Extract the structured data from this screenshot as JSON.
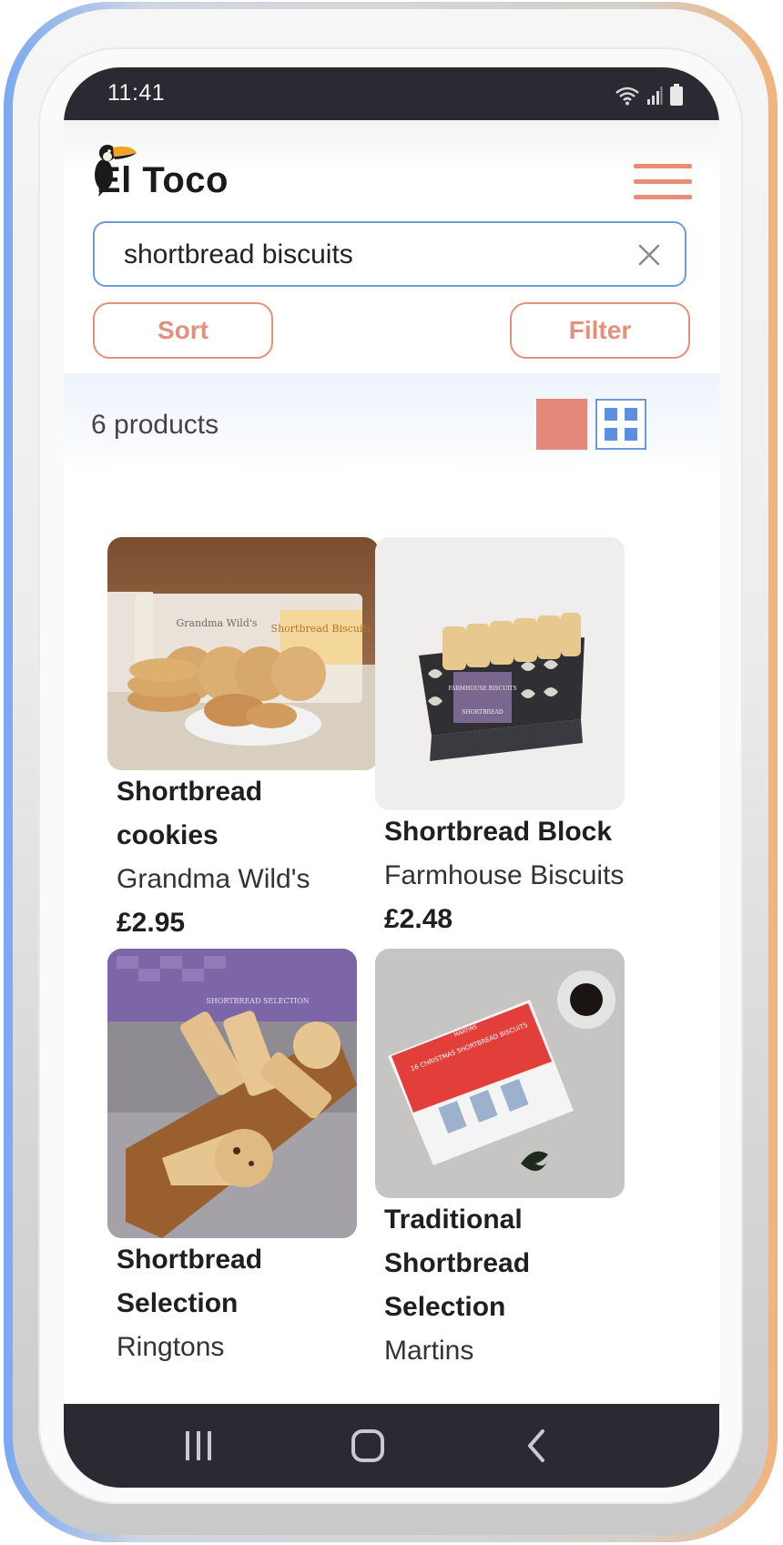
{
  "status_bar": {
    "time": "11:41"
  },
  "header": {
    "logo_text": "El Toco",
    "menu_icon": "hamburger-icon"
  },
  "search": {
    "value": "shortbread biscuits",
    "clear_icon": "close-icon"
  },
  "controls": {
    "sort_label": "Sort",
    "filter_label": "Filter"
  },
  "results": {
    "count_label": "6 products",
    "view_toggles": [
      "list-view-icon",
      "grid-view-icon"
    ]
  },
  "products": [
    {
      "name_line1": "Shortbread",
      "name_line2": "cookies",
      "name_line3": "",
      "brand": "Grandma Wild's",
      "price": "£2.95"
    },
    {
      "name_line1": "Shortbread Block",
      "name_line2": "",
      "name_line3": "",
      "brand": "Farmhouse Biscuits",
      "price": "£2.48"
    },
    {
      "name_line1": "Shortbread",
      "name_line2": "Selection",
      "name_line3": "",
      "brand": "Ringtons",
      "price": ""
    },
    {
      "name_line1": "Traditional",
      "name_line2": "Shortbread",
      "name_line3": "Selection",
      "brand": "Martins",
      "price": ""
    }
  ],
  "image_labels": {
    "p1_pack_brand": "Grandma Wild's",
    "p1_pack_title": "Shortbread Biscuits",
    "p2_pack_brand": "FARMHOUSE BISCUITS",
    "p2_pack_title": "SHORTBREAD",
    "p3_box": "SHORTBREAD SELECTION",
    "p4_box_brand": "MARTINS",
    "p4_box_title": "16 CHRISTMAS SHORTBREAD BISCUITS"
  },
  "colors": {
    "accent": "#e4907c",
    "focus_blue": "#6e9ad8",
    "system_bar": "#2b2a33"
  },
  "nav_bar": {
    "icons": [
      "recent-apps-icon",
      "home-icon",
      "back-icon"
    ]
  }
}
